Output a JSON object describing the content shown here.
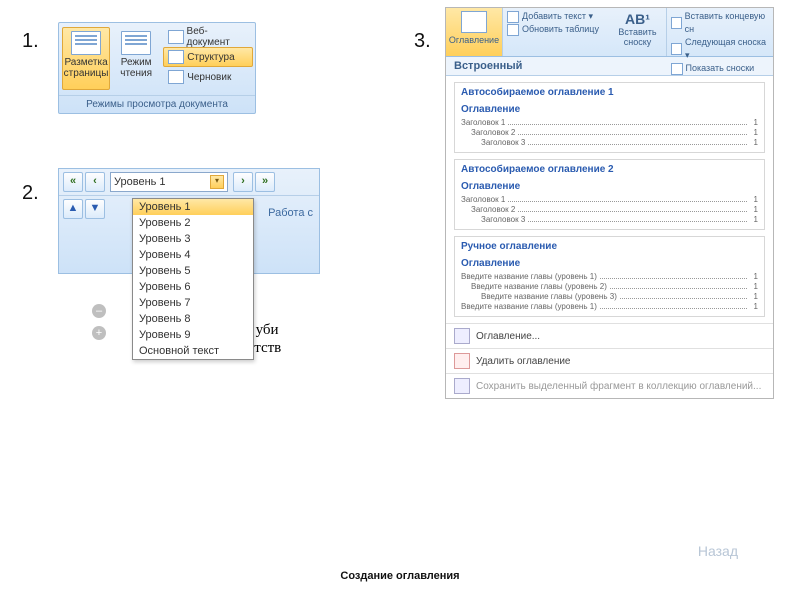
{
  "labels": {
    "n1": "1.",
    "n2": "2.",
    "n3": "3."
  },
  "panel1": {
    "btn_page_layout": "Разметка страницы",
    "btn_reading": "Режим чтения",
    "btn_web": "Веб-документ",
    "btn_structure": "Структура",
    "btn_draft": "Черновик",
    "caption": "Режимы просмотра документа"
  },
  "panel2": {
    "combo_value": "Уровень 1",
    "side_label": "Работа с",
    "options": [
      "Уровень 1",
      "Уровень 2",
      "Уровень 3",
      "Уровень 4",
      "Уровень 5",
      "Уровень 6",
      "Уровень 7",
      "Уровень 8",
      "Уровень 9",
      "Основной текст"
    ],
    "fragment1": "ных·уби",
    "fragment2": "тветств"
  },
  "panel3": {
    "ribbon": {
      "toc_btn": "Оглавление",
      "add_text": "Добавить текст ▾",
      "update_table": "Обновить таблицу",
      "insert_footnote": "Вставить сноску",
      "ab_label": "AB¹",
      "end_note": "Вставить концевую сн",
      "next_note": "Следующая сноска ▾",
      "show_notes": "Показать сноски"
    },
    "header": "Встроенный",
    "card1": {
      "title": "Автособираемое оглавление 1",
      "heading": "Оглавление",
      "lines": [
        {
          "t": "Заголовок 1",
          "p": "1",
          "ind": 0
        },
        {
          "t": "Заголовок 2",
          "p": "1",
          "ind": 1
        },
        {
          "t": "Заголовок 3",
          "p": "1",
          "ind": 2
        }
      ]
    },
    "card2": {
      "title": "Автособираемое оглавление 2",
      "heading": "Оглавление",
      "lines": [
        {
          "t": "Заголовок 1",
          "p": "1",
          "ind": 0
        },
        {
          "t": "Заголовок 2",
          "p": "1",
          "ind": 1
        },
        {
          "t": "Заголовок 3",
          "p": "1",
          "ind": 2
        }
      ]
    },
    "card3": {
      "title": "Ручное оглавление",
      "heading": "Оглавление",
      "lines": [
        {
          "t": "Введите название главы (уровень 1)",
          "p": "1",
          "ind": 0
        },
        {
          "t": "Введите название главы (уровень 2)",
          "p": "1",
          "ind": 1
        },
        {
          "t": "Введите название главы (уровень 3)",
          "p": "1",
          "ind": 2
        },
        {
          "t": "Введите название главы (уровень 1)",
          "p": "1",
          "ind": 0
        }
      ]
    },
    "opt_toc": "Оглавление...",
    "opt_remove": "Удалить оглавление",
    "opt_save": "Сохранить выделенный фрагмент в коллекцию оглавлений..."
  },
  "footer": {
    "back": "Назад",
    "caption": "Создание оглавления"
  }
}
